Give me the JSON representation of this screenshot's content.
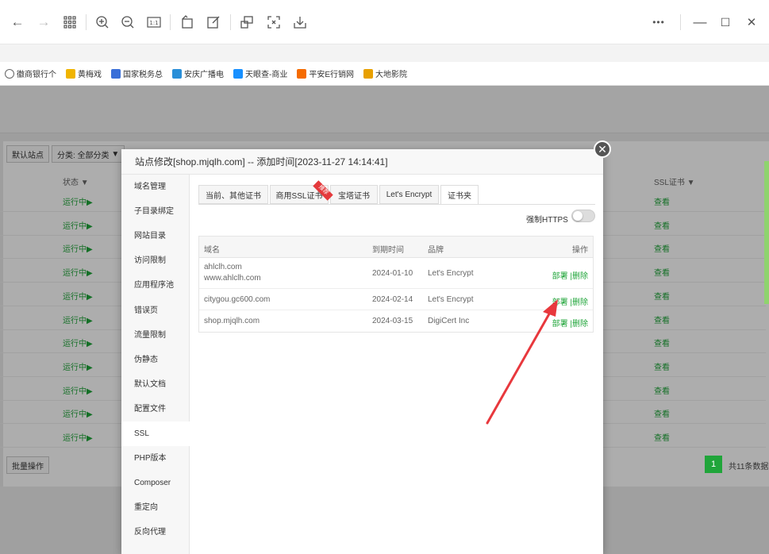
{
  "browser": {
    "more_icon": "•••",
    "bookmarks": [
      {
        "label": "徽商银行个",
        "icon": "globe-icon",
        "color": "#666666"
      },
      {
        "label": "黄梅戏",
        "icon": "folder-icon",
        "color": "#f0b400"
      },
      {
        "label": "国家税务总",
        "icon": "tax-icon",
        "color": "#3a6fd8"
      },
      {
        "label": "安庆广播电",
        "icon": "lock-icon",
        "color": "#2a8fd8"
      },
      {
        "label": "天眼查-商业",
        "icon": "tianyancha-icon",
        "color": "#1890ff"
      },
      {
        "label": "平安E行销网",
        "icon": "pingan-icon",
        "color": "#f56b00"
      },
      {
        "label": "大地影院",
        "icon": "cinema-icon",
        "color": "#e8a000"
      }
    ]
  },
  "background": {
    "default_site_btn": "默认站点",
    "category_btn": "分类: 全部分类",
    "status_header": "状态",
    "ssl_header": "SSL证书",
    "running_label": "运行中▶",
    "view_label": "查看",
    "row_count": 11,
    "batch_btn": "批量操作",
    "page_num": "1",
    "page_info": "共11条数据"
  },
  "modal": {
    "title": "站点修改[shop.mjqlh.com] -- 添加时间[2023-11-27 14:14:41]",
    "close_symbol": "✕",
    "sidebar": [
      "域名管理",
      "子目录绑定",
      "网站目录",
      "访问限制",
      "应用程序池",
      "错误页",
      "流量限制",
      "伪静态",
      "默认文档",
      "配置文件",
      "SSL",
      "PHP版本",
      "Composer",
      "重定向",
      "反向代理"
    ],
    "active_side": "SSL",
    "tabs": [
      "当前、其他证书",
      "商用SSL证书",
      "宝塔证书",
      "Let's Encrypt",
      "证书夹"
    ],
    "active_tab": "证书夹",
    "ribbon_text": "推荐",
    "force_https_label": "强制HTTPS",
    "force_https_on": false,
    "table": {
      "headers": {
        "domain": "域名",
        "expire": "到期时间",
        "brand": "品牌",
        "action": "操作"
      },
      "rows": [
        {
          "domain1": "ahlclh.com",
          "domain2": "www.ahlclh.com",
          "expire": "2024-01-10",
          "brand": "Let's Encrypt"
        },
        {
          "domain1": "citygou.gc600.com",
          "domain2": "",
          "expire": "2024-02-14",
          "brand": "Let's Encrypt"
        },
        {
          "domain1": "shop.mjqlh.com",
          "domain2": "",
          "expire": "2024-03-15",
          "brand": "DigiCert Inc"
        }
      ],
      "deploy_label": "部署",
      "delete_label": "删除",
      "action_sep": "|"
    }
  },
  "colors": {
    "accent_green": "#20a53a",
    "arrow_red": "#e8383d"
  }
}
